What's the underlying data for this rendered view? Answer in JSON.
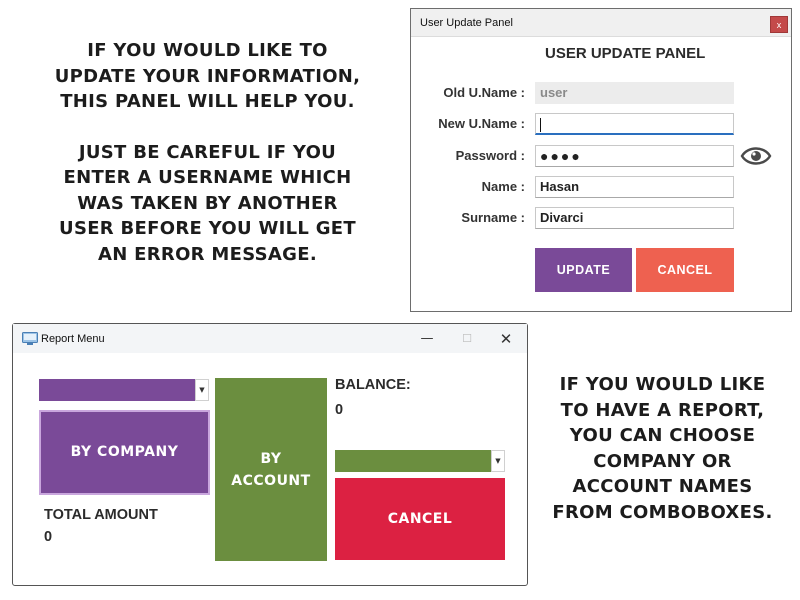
{
  "captions": {
    "top": [
      "IF YOU WOULD LIKE TO",
      "UPDATE YOUR INFORMATION,",
      "THIS PANEL WILL HELP YOU."
    ],
    "top2": [
      "JUST BE CAREFUL IF YOU",
      "ENTER A USERNAME WHICH",
      "WAS TAKEN BY ANOTHER",
      "USER BEFORE YOU WILL GET",
      "AN ERROR MESSAGE."
    ],
    "right": [
      "IF YOU WOULD LIKE",
      "TO HAVE A REPORT,",
      "YOU CAN CHOOSE",
      "COMPANY OR",
      "ACCOUNT NAMES",
      "FROM COMBOBOXES."
    ]
  },
  "update_panel": {
    "window_title": "User Update Panel",
    "close_glyph": "x",
    "heading": "USER UPDATE PANEL",
    "fields": {
      "old_username": {
        "label": "Old U.Name :",
        "value": "user"
      },
      "new_username": {
        "label": "New U.Name :",
        "value": ""
      },
      "password": {
        "label": "Password :",
        "value": "●●●●"
      },
      "name": {
        "label": "Name :",
        "value": "Hasan"
      },
      "surname": {
        "label": "Surname :",
        "value": "Divarci"
      }
    },
    "update_label": "UPDATE",
    "cancel_label": "CANCEL",
    "colors": {
      "update": "#7a4a98",
      "cancel": "#ee6150",
      "close": "#c44a4a"
    }
  },
  "report_menu": {
    "window_title": "Report Menu",
    "min_glyph": "—",
    "max_glyph": "☐",
    "close_glyph": "✕",
    "company_combo_value": "",
    "account_combo_value": "",
    "by_company_label": "BY COMPANY",
    "by_account_label_1": "BY",
    "by_account_label_2": "ACCOUNT",
    "cancel_label": "CANCEL",
    "balance_label": "BALANCE:",
    "balance_value": "0",
    "total_amount_label": "TOTAL AMOUNT",
    "total_amount_value": "0",
    "colors": {
      "company": "#7a4a98",
      "account": "#6b8e3f",
      "cancel": "#dc2142"
    }
  }
}
